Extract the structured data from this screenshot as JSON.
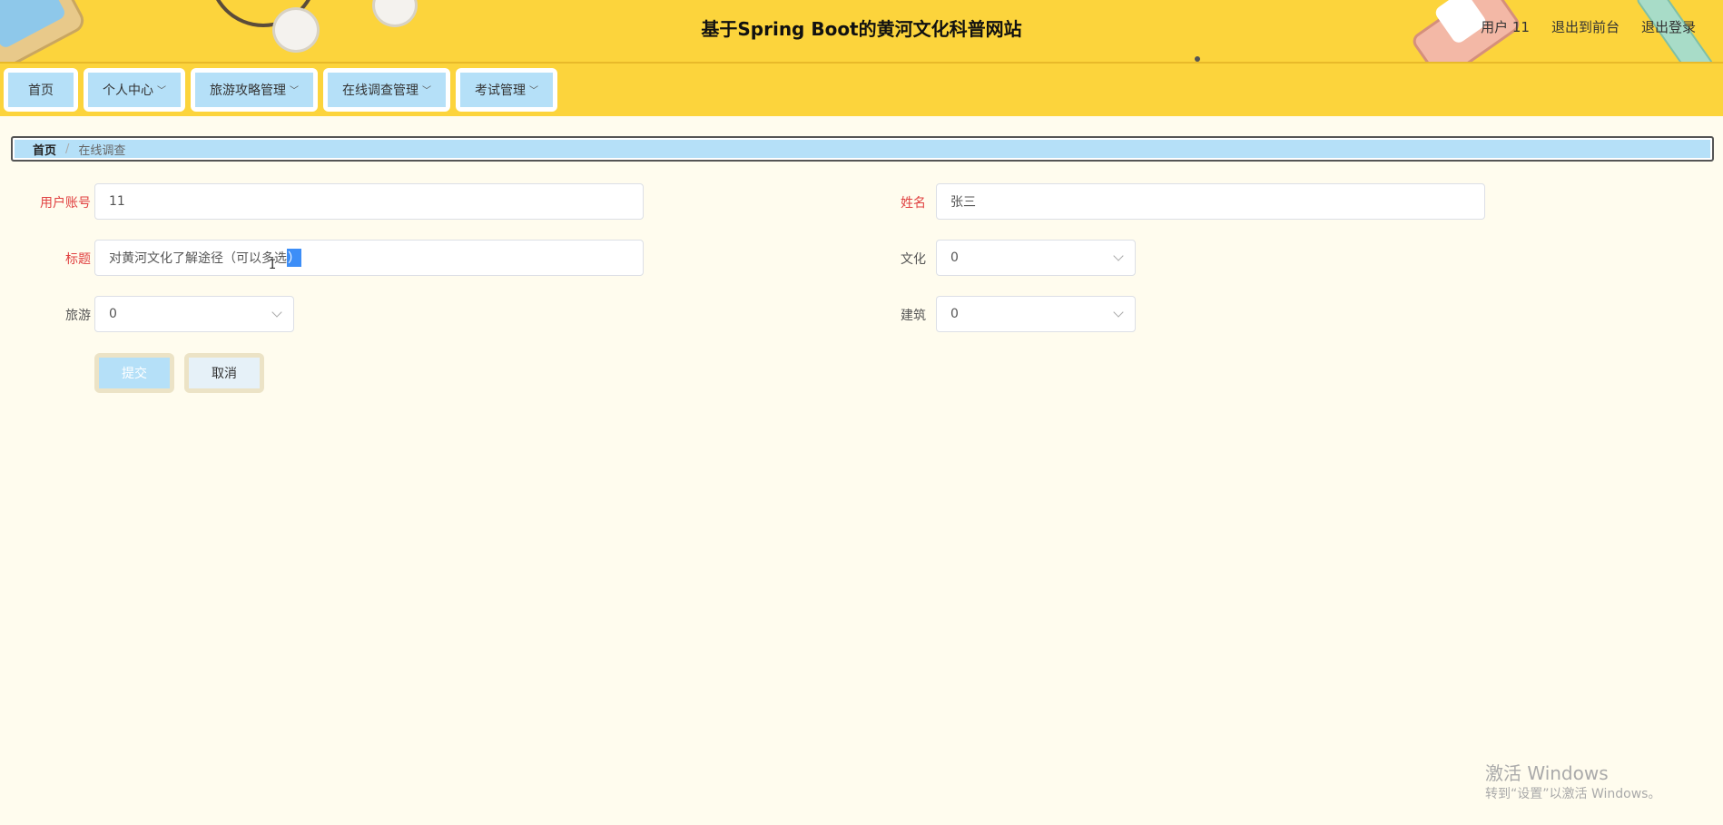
{
  "header": {
    "title": "基于Spring Boot的黄河文化科普网站",
    "links": [
      "用户 11",
      "退出到前台",
      "退出登录"
    ],
    "bg_color": "#fcd43c"
  },
  "nav": {
    "items": [
      {
        "label": "首页",
        "has_dropdown": false
      },
      {
        "label": "个人中心",
        "has_dropdown": true
      },
      {
        "label": "旅游攻略管理",
        "has_dropdown": true
      },
      {
        "label": "在线调查管理",
        "has_dropdown": true
      },
      {
        "label": "考试管理",
        "has_dropdown": true
      }
    ],
    "item_color": "#b5e0f8"
  },
  "breadcrumb": {
    "home": "首页",
    "separator": "/",
    "current": "在线调查"
  },
  "form": {
    "user_account": {
      "label": "用户账号",
      "value": "11"
    },
    "name": {
      "label": "姓名",
      "value": "张三"
    },
    "title": {
      "label": "标题",
      "value_before": "对黄河文化了解途径（可以多选",
      "value_selected": "）"
    },
    "culture": {
      "label": "文化",
      "value": "0"
    },
    "tourism": {
      "label": "旅游",
      "value": "0"
    },
    "architecture": {
      "label": "建筑",
      "value": "0"
    },
    "submit_label": "提交",
    "cancel_label": "取消"
  },
  "watermark": {
    "title": "激活 Windows",
    "subtitle": "转到“设置”以激活 Windows。"
  }
}
